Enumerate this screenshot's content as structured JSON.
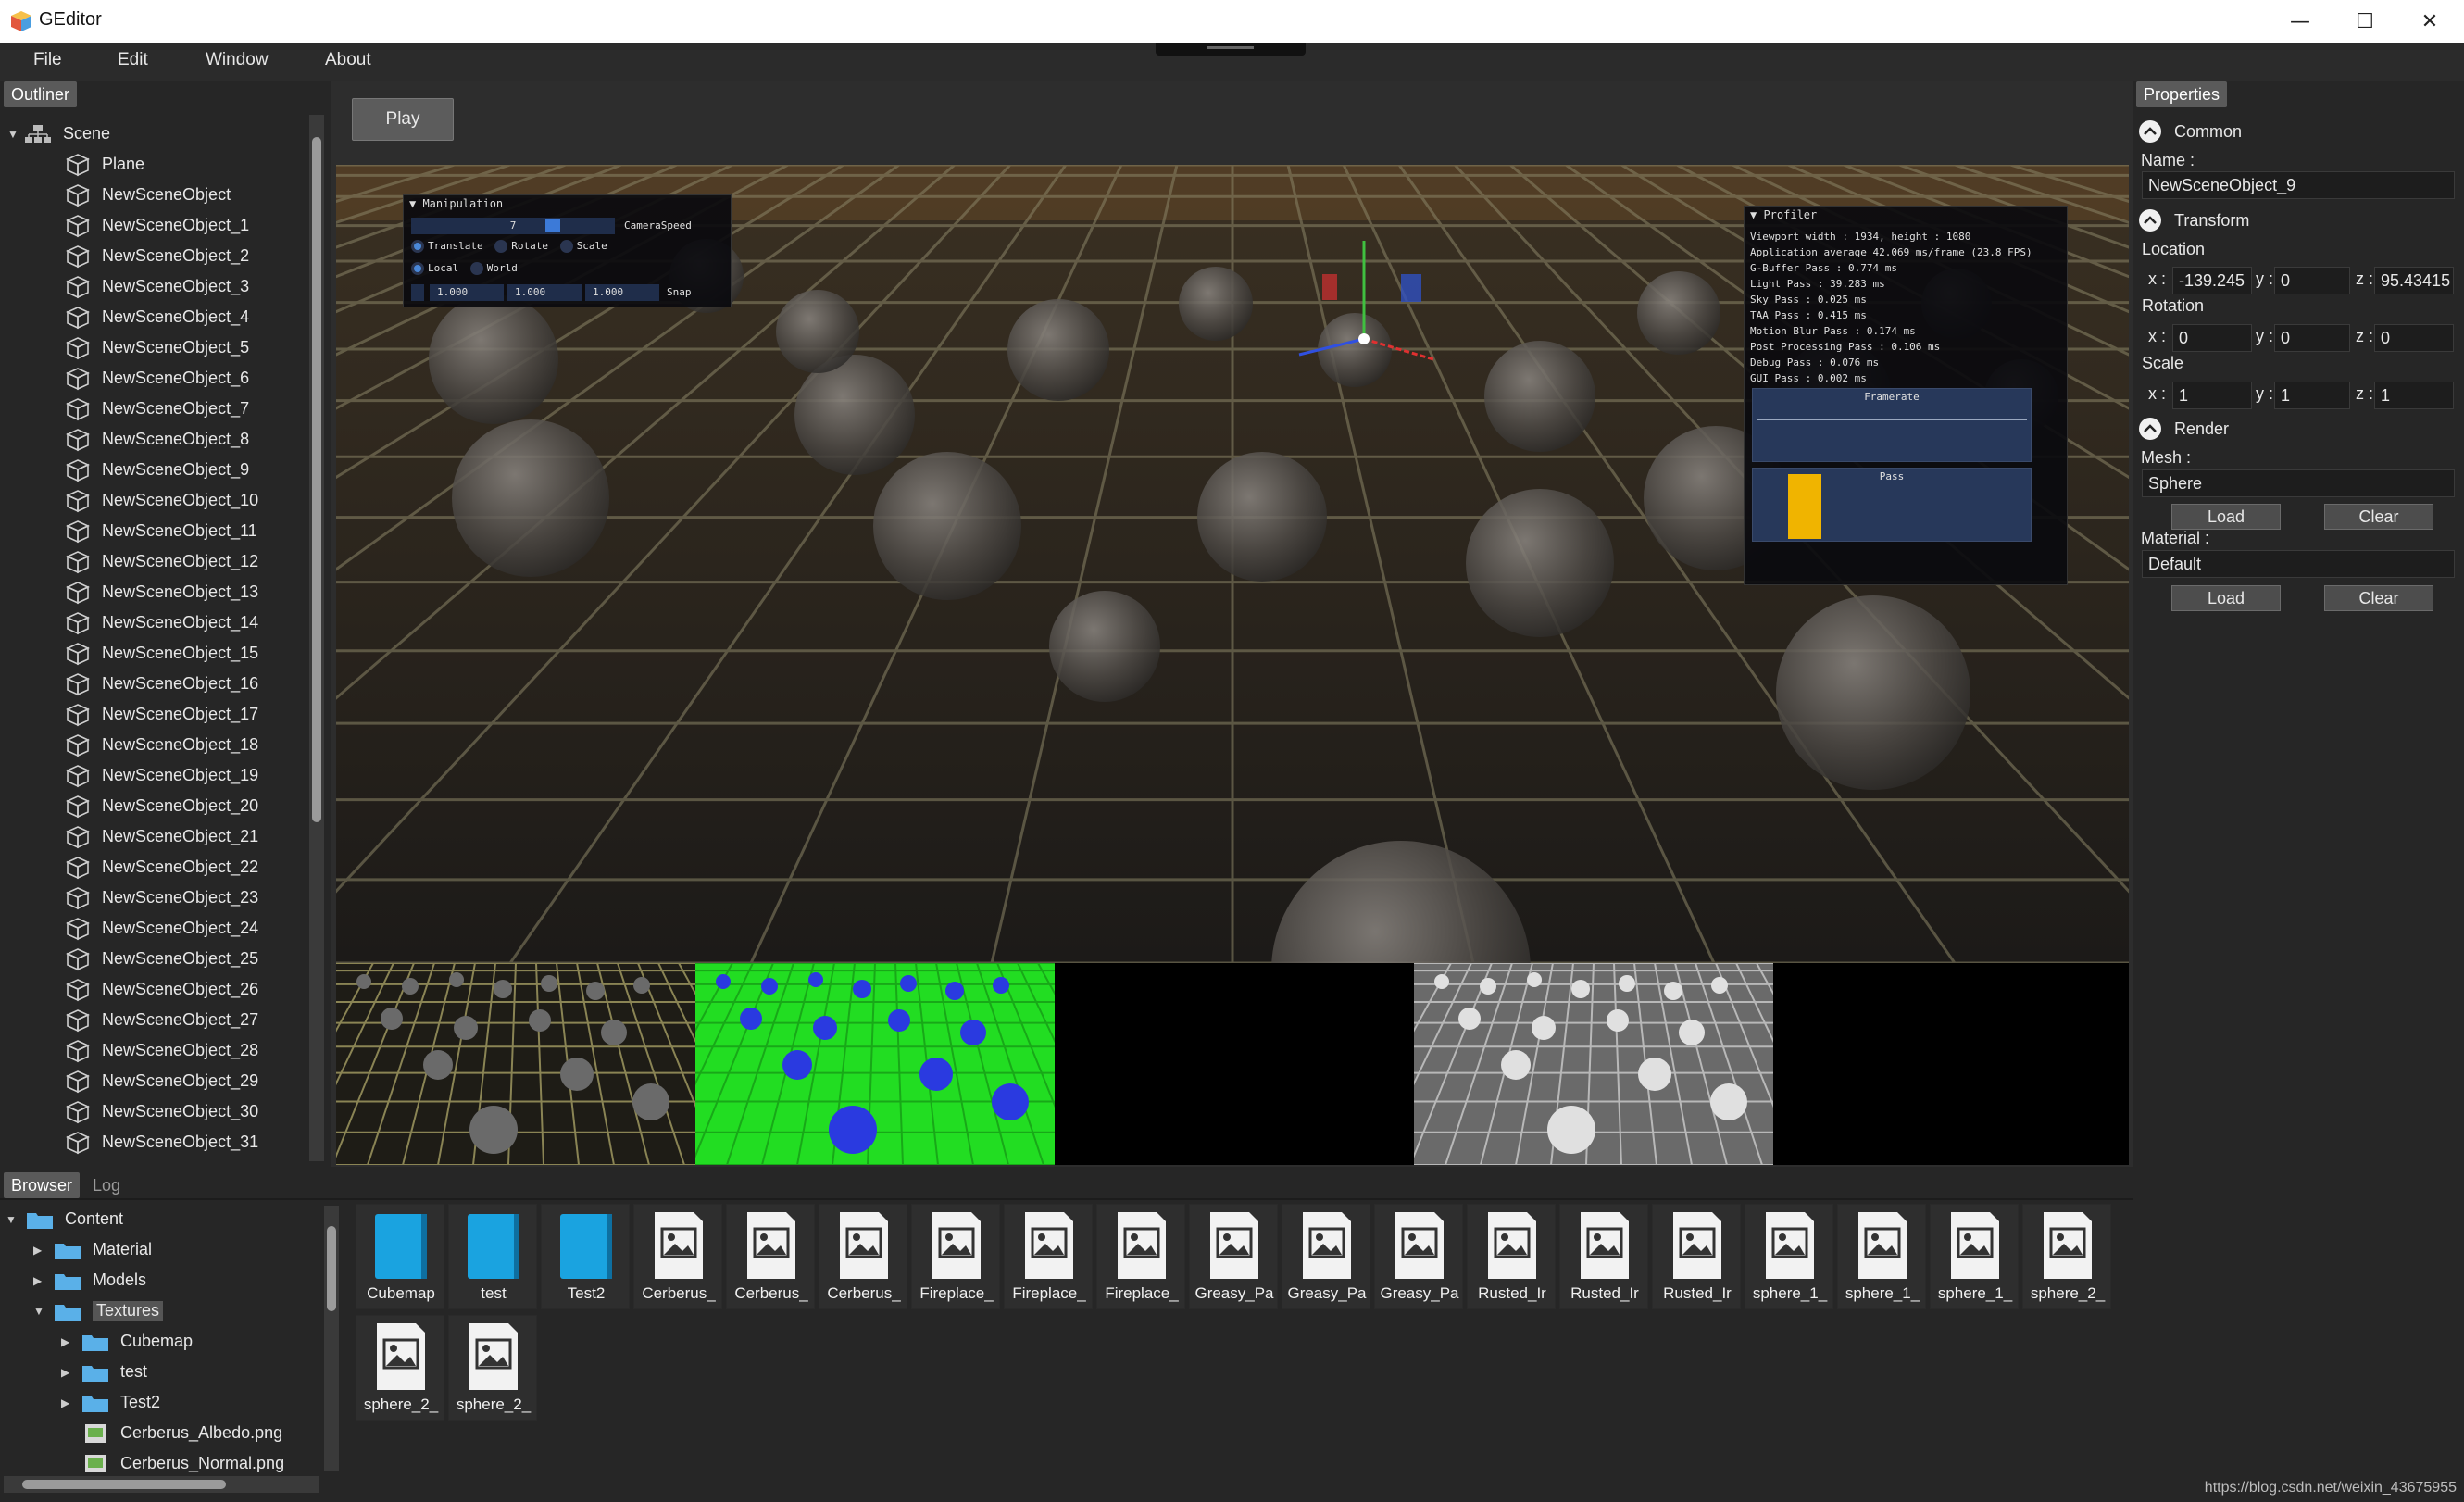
{
  "window": {
    "title": "GEditor",
    "minimize": "—",
    "maximize": "☐",
    "close": "✕"
  },
  "menu": [
    "File",
    "Edit",
    "Window",
    "About"
  ],
  "outliner": {
    "tab": "Outliner",
    "root": "Scene",
    "items": [
      "Plane",
      "NewSceneObject",
      "NewSceneObject_1",
      "NewSceneObject_2",
      "NewSceneObject_3",
      "NewSceneObject_4",
      "NewSceneObject_5",
      "NewSceneObject_6",
      "NewSceneObject_7",
      "NewSceneObject_8",
      "NewSceneObject_9",
      "NewSceneObject_10",
      "NewSceneObject_11",
      "NewSceneObject_12",
      "NewSceneObject_13",
      "NewSceneObject_14",
      "NewSceneObject_15",
      "NewSceneObject_16",
      "NewSceneObject_17",
      "NewSceneObject_18",
      "NewSceneObject_19",
      "NewSceneObject_20",
      "NewSceneObject_21",
      "NewSceneObject_22",
      "NewSceneObject_23",
      "NewSceneObject_24",
      "NewSceneObject_25",
      "NewSceneObject_26",
      "NewSceneObject_27",
      "NewSceneObject_28",
      "NewSceneObject_29",
      "NewSceneObject_30",
      "NewSceneObject_31"
    ]
  },
  "viewport": {
    "play_label": "Play",
    "manipulation": {
      "title": "▼ Manipulation",
      "camera_speed_value": "7",
      "camera_speed_label": "CameraSpeed",
      "modes": [
        "Translate",
        "Rotate",
        "Scale"
      ],
      "spaces": [
        "Local",
        "World"
      ],
      "snap_values": [
        "1.000",
        "1.000",
        "1.000"
      ],
      "snap_label": "Snap"
    },
    "profiler": {
      "title": "▼ Profiler",
      "lines": [
        "Viewport width : 1934, height : 1080",
        "Application average 42.069 ms/frame (23.8 FPS)",
        "G-Buffer Pass : 0.774 ms",
        "Light Pass : 39.283 ms",
        "Sky Pass : 0.025 ms",
        "TAA Pass : 0.415 ms",
        "Motion Blur Pass : 0.174 ms",
        "Post Processing Pass : 0.106 ms",
        "Debug Pass : 0.076 ms",
        "GUI Pass : 0.002 ms"
      ],
      "framerate_label": "Framerate",
      "pass_label": "Pass",
      "pass_bar_color": "#f0b400"
    }
  },
  "properties": {
    "tab": "Properties",
    "common_label": "Common",
    "name_label": "Name :",
    "name_value": "NewSceneObject_9",
    "transform_label": "Transform",
    "location_label": "Location",
    "location": {
      "x": "-139.245",
      "y": "0",
      "z": "95.43415"
    },
    "rotation_label": "Rotation",
    "rotation": {
      "x": "0",
      "y": "0",
      "z": "0"
    },
    "scale_label": "Scale",
    "scale": {
      "x": "1",
      "y": "1",
      "z": "1"
    },
    "axis": {
      "x": "x :",
      "y": "y :",
      "z": "z :"
    },
    "render_label": "Render",
    "mesh_label": "Mesh :",
    "mesh_value": "Sphere",
    "material_label": "Material :",
    "material_value": "Default",
    "load_label": "Load",
    "clear_label": "Clear"
  },
  "browser": {
    "tabs": [
      "Browser",
      "Log"
    ],
    "tree": [
      {
        "label": "Content",
        "arrow": "▼",
        "kind": "folder"
      },
      {
        "label": "Material",
        "arrow": "▶",
        "kind": "folder"
      },
      {
        "label": "Models",
        "arrow": "▶",
        "kind": "folder"
      },
      {
        "label": "Textures",
        "arrow": "▼",
        "kind": "folder",
        "selected": true
      },
      {
        "label": "Cubemap",
        "arrow": "▶",
        "kind": "folder"
      },
      {
        "label": "test",
        "arrow": "▶",
        "kind": "folder"
      },
      {
        "label": "Test2",
        "arrow": "▶",
        "kind": "folder"
      },
      {
        "label": "Cerberus_Albedo.png",
        "arrow": "",
        "kind": "image"
      },
      {
        "label": "Cerberus_Normal.png",
        "arrow": "",
        "kind": "image"
      }
    ],
    "assets": [
      {
        "label": "Cubemap",
        "kind": "folder"
      },
      {
        "label": "test",
        "kind": "folder"
      },
      {
        "label": "Test2",
        "kind": "folder"
      },
      {
        "label": "Cerberus_",
        "kind": "image"
      },
      {
        "label": "Cerberus_",
        "kind": "image"
      },
      {
        "label": "Cerberus_",
        "kind": "image"
      },
      {
        "label": "Fireplace_",
        "kind": "image"
      },
      {
        "label": "Fireplace_",
        "kind": "image"
      },
      {
        "label": "Fireplace_",
        "kind": "image"
      },
      {
        "label": "Greasy_Pa",
        "kind": "image"
      },
      {
        "label": "Greasy_Pa",
        "kind": "image"
      },
      {
        "label": "Greasy_Pa",
        "kind": "image"
      },
      {
        "label": "Rusted_Ir",
        "kind": "image"
      },
      {
        "label": "Rusted_Ir",
        "kind": "image"
      },
      {
        "label": "Rusted_Ir",
        "kind": "image"
      },
      {
        "label": "sphere_1_",
        "kind": "image"
      },
      {
        "label": "sphere_1_",
        "kind": "image"
      },
      {
        "label": "sphere_1_",
        "kind": "image"
      },
      {
        "label": "sphere_2_",
        "kind": "image"
      },
      {
        "label": "sphere_2_",
        "kind": "image"
      },
      {
        "label": "sphere_2_",
        "kind": "image"
      }
    ]
  },
  "watermark": "https://blog.csdn.net/weixin_43675955",
  "colors": {
    "accent_blue": "#1aa3e0",
    "folder_blue": "#5ab0e8",
    "selection": "#555555"
  }
}
